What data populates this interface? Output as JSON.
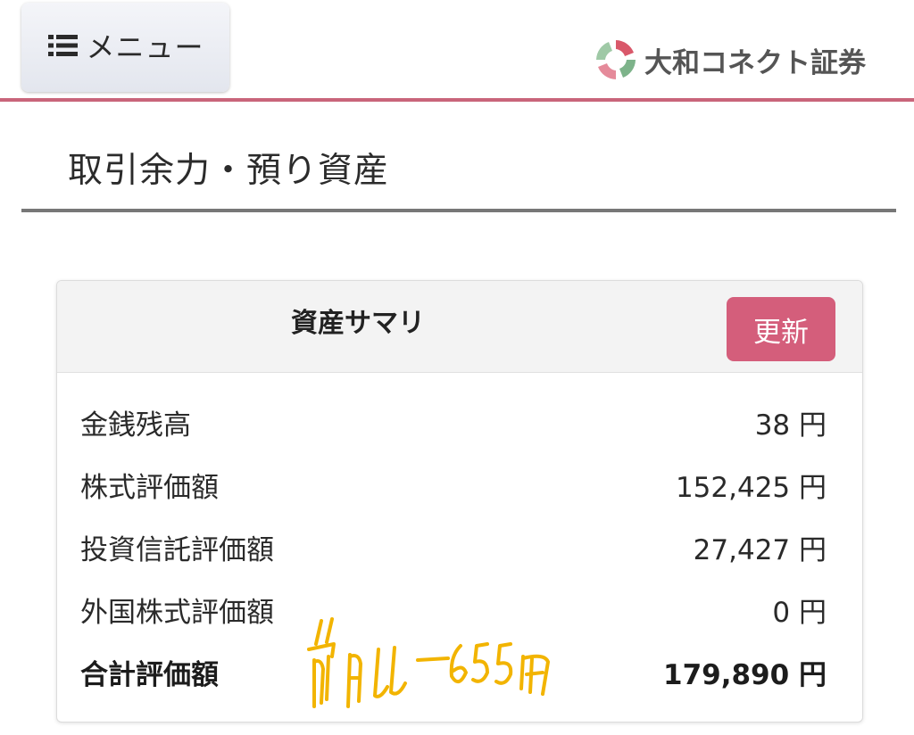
{
  "header": {
    "menu_label": "メニュー",
    "logo_text": "大和コネクト証券",
    "accent_color": "#c9657a"
  },
  "page": {
    "title": "取引余力・預り資産"
  },
  "summary": {
    "title": "資産サマリ",
    "refresh_label": "更新",
    "rows": [
      {
        "label": "金銭残高",
        "value": "38 円"
      },
      {
        "label": "株式評価額",
        "value": "152,425 円"
      },
      {
        "label": "投資信託評価額",
        "value": "27,427 円"
      },
      {
        "label": "外国株式評価額",
        "value": "0 円"
      }
    ],
    "total": {
      "label": "合計評価額",
      "value": "179,890 円"
    }
  },
  "annotation": {
    "text": "11 前日比 -655円",
    "color": "#f2b400"
  },
  "icons": [
    "list-icon",
    "logo-mark-icon"
  ]
}
